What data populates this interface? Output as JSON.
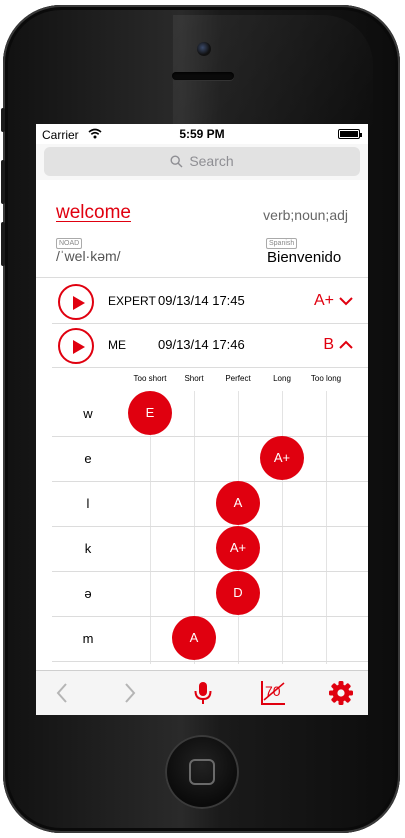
{
  "status_bar": {
    "carrier": "Carrier",
    "time": "5:59 PM"
  },
  "search": {
    "placeholder": "Search"
  },
  "entry": {
    "word": "welcome",
    "parts_of_speech": "verb;noun;adj",
    "dictionary_tag": "NOAD",
    "phonetic": "/ˈwel·kəm/",
    "language_tag": "Spanish",
    "translation": "Bienvenido"
  },
  "recordings": [
    {
      "who": "EXPERT",
      "date": "09/13/14 17:45",
      "grade": "A+",
      "expanded": false
    },
    {
      "who": "ME",
      "date": "09/13/14 17:46",
      "grade": "B",
      "expanded": true
    }
  ],
  "timing_columns": [
    "Too short",
    "Short",
    "Perfect",
    "Long",
    "Too long"
  ],
  "phonemes": [
    {
      "symbol": "w",
      "grade": "E",
      "timing": "Too short"
    },
    {
      "symbol": "e",
      "grade": "A+",
      "timing": "Long"
    },
    {
      "symbol": "l",
      "grade": "A",
      "timing": "Perfect"
    },
    {
      "symbol": "k",
      "grade": "A+",
      "timing": "Perfect"
    },
    {
      "symbol": "ə",
      "grade": "D",
      "timing": "Perfect"
    },
    {
      "symbol": "m",
      "grade": "A",
      "timing": "Between Short and Perfect"
    }
  ],
  "toolbar": {
    "back_icon": "chevron-left-icon",
    "forward_icon": "chevron-right-icon",
    "mic_icon": "microphone-icon",
    "score_label": "70",
    "settings_icon": "gear-icon"
  },
  "colors": {
    "accent": "#e0000f",
    "disabled": "#b5b5b5"
  }
}
